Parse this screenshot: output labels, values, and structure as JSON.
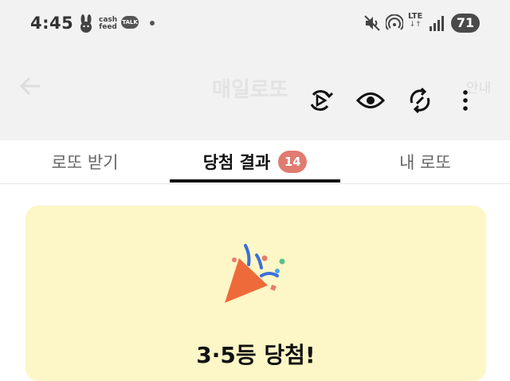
{
  "status_bar": {
    "time": "4:45",
    "cashfeed_line1": "cash",
    "cashfeed_line2": "feed",
    "talk_label": "TALK",
    "network_label": "LTE",
    "battery_level": "71"
  },
  "header": {
    "title": "매일로또",
    "guide_label": "안내"
  },
  "tabs": [
    {
      "label": "로또 받기"
    },
    {
      "label": "당첨 결과",
      "badge": "14"
    },
    {
      "label": "내 로또"
    }
  ],
  "result_card": {
    "headline": "3·5등 당첨!"
  },
  "colors": {
    "accent_badge": "#e07b72",
    "card_background": "#fdf6c6",
    "confetti_cone": "#ef6a3a"
  }
}
